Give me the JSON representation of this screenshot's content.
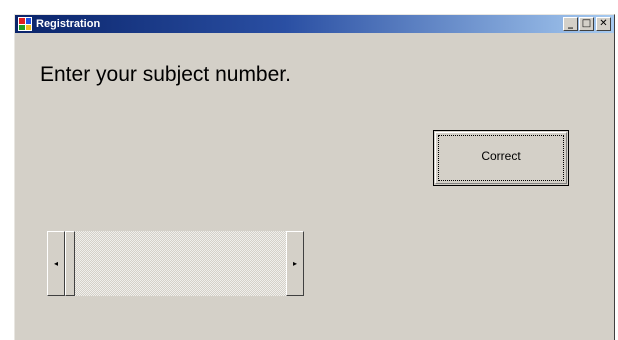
{
  "window": {
    "title": "Registration",
    "controls": {
      "minimize_glyph": "_",
      "maximize_glyph": "□",
      "close_glyph": "✕"
    }
  },
  "prompt": {
    "text": "Enter your subject number."
  },
  "correct_button": {
    "label": "Correct"
  },
  "scrollbar": {
    "left_arrow_glyph": "◂",
    "right_arrow_glyph": "▸",
    "position": 0
  },
  "colors": {
    "titlebar_start": "#0a246a",
    "titlebar_end": "#a6caf0",
    "window_face": "#d4d0c8"
  },
  "icons": {
    "app": "app-icon",
    "minimize": "minimize-icon",
    "maximize": "maximize-icon",
    "close": "close-icon"
  }
}
